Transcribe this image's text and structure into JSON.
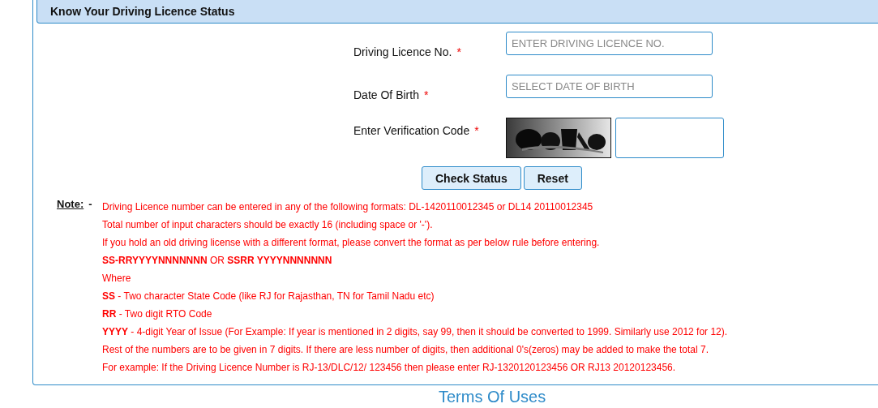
{
  "panel": {
    "title": "Know Your Driving Licence Status"
  },
  "form": {
    "fields": [
      {
        "kind": "text",
        "label": "Driving Licence No.",
        "required_mark": "*",
        "placeholder": "ENTER DRIVING LICENCE NO."
      },
      {
        "kind": "text",
        "label": "Date Of Birth",
        "required_mark": "*",
        "placeholder": "SELECT DATE OF BIRTH"
      },
      {
        "kind": "captcha",
        "label": "Enter Verification Code",
        "required_mark": "*"
      }
    ],
    "buttons": [
      "Check Status",
      "Reset"
    ]
  },
  "note": {
    "label": "Note:",
    "separator": "-",
    "lines": [
      "Driving Licence number can be entered in any of the following formats: DL-1420110012345 or DL14 20110012345",
      "Total number of input characters should be exactly 16 (including space or '-').",
      "If you hold an old driving license with a different format, please convert the format as per below rule before entering.",
      "**SS-RRYYYYNNNNNNN** OR **SSRR YYYYNNNNNNN**",
      "Where",
      "**SS** - Two character State Code (like RJ for Rajasthan, TN for Tamil Nadu etc)",
      "**RR** - Two digit RTO Code",
      "**YYYY** - 4-digit Year of Issue (For Example: If year is mentioned in 2 digits, say 99, then it should be converted to 1999. Similarly use 2012 for 12).",
      "Rest of the numbers are to be given in 7 digits. If there are less number of digits, then additional 0's(zeros) may be added to make the total 7.",
      "For example: If the Driving Licence Number is RJ-13/DLC/12/ 123456 then please enter RJ-1320120123456 OR RJ13 20120123456."
    ]
  },
  "footer": {
    "heading": "Terms Of Uses"
  }
}
